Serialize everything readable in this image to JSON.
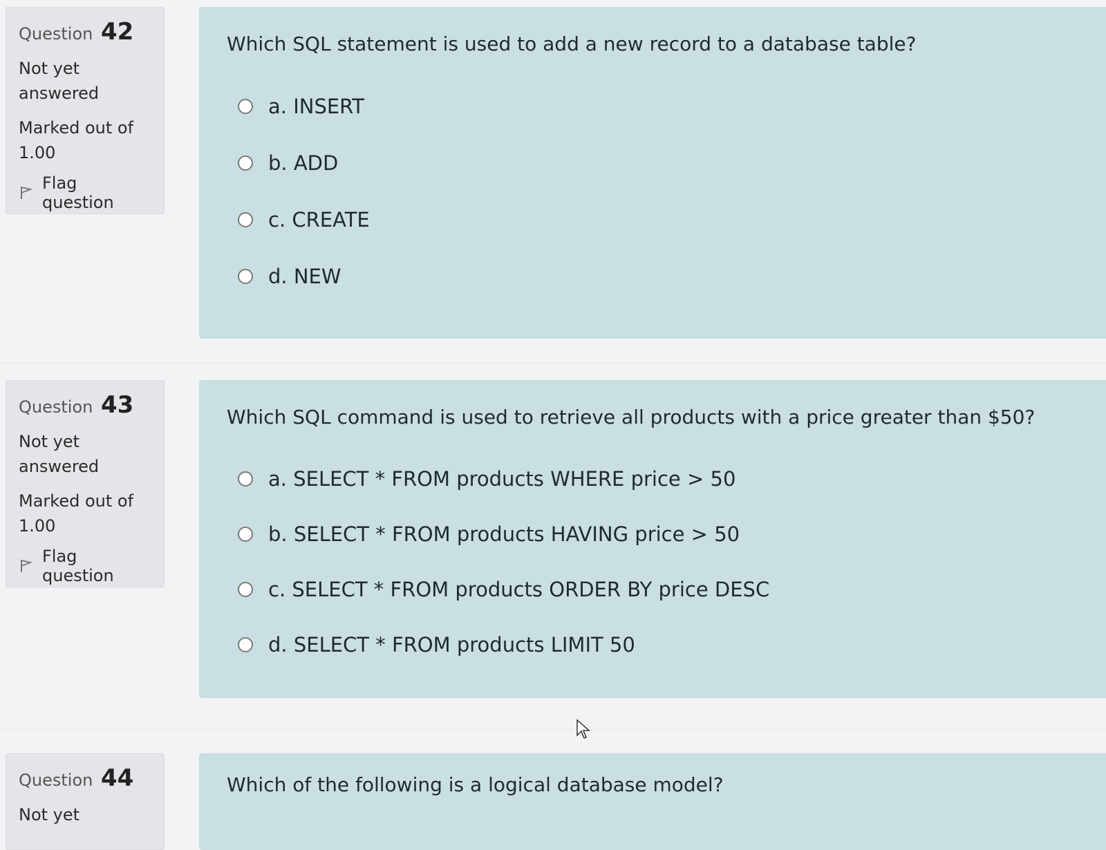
{
  "questions": [
    {
      "label": "Question",
      "number": "42",
      "state": "Not yet answered",
      "grade_label": "Marked out of",
      "grade_value": "1.00",
      "flag_label": "Flag question",
      "text": "Which SQL statement is used to add a new record to a database table?",
      "answers": [
        "a. INSERT",
        "b. ADD",
        "c. CREATE",
        "d. NEW"
      ]
    },
    {
      "label": "Question",
      "number": "43",
      "state": "Not yet answered",
      "grade_label": "Marked out of",
      "grade_value": "1.00",
      "flag_label": "Flag question",
      "text": "Which SQL command is used to retrieve all products with a price greater than $50?",
      "answers": [
        "a. SELECT * FROM products WHERE price > 50",
        "b. SELECT * FROM products HAVING price > 50",
        "c. SELECT * FROM products ORDER BY price DESC",
        "d. SELECT * FROM products LIMIT 50"
      ]
    },
    {
      "label": "Question",
      "number": "44",
      "state": "Not yet",
      "text": "Which of the following is a logical database model?"
    }
  ],
  "icons": {
    "flag": "flag-icon",
    "radio": "radio-icon",
    "cursor": "mouse-cursor-icon"
  },
  "colors": {
    "page_bg": "#f2f3f4",
    "info_bg": "#e3e5e8",
    "content_bg": "#c9dfe2",
    "text": "#1f2a2e"
  }
}
